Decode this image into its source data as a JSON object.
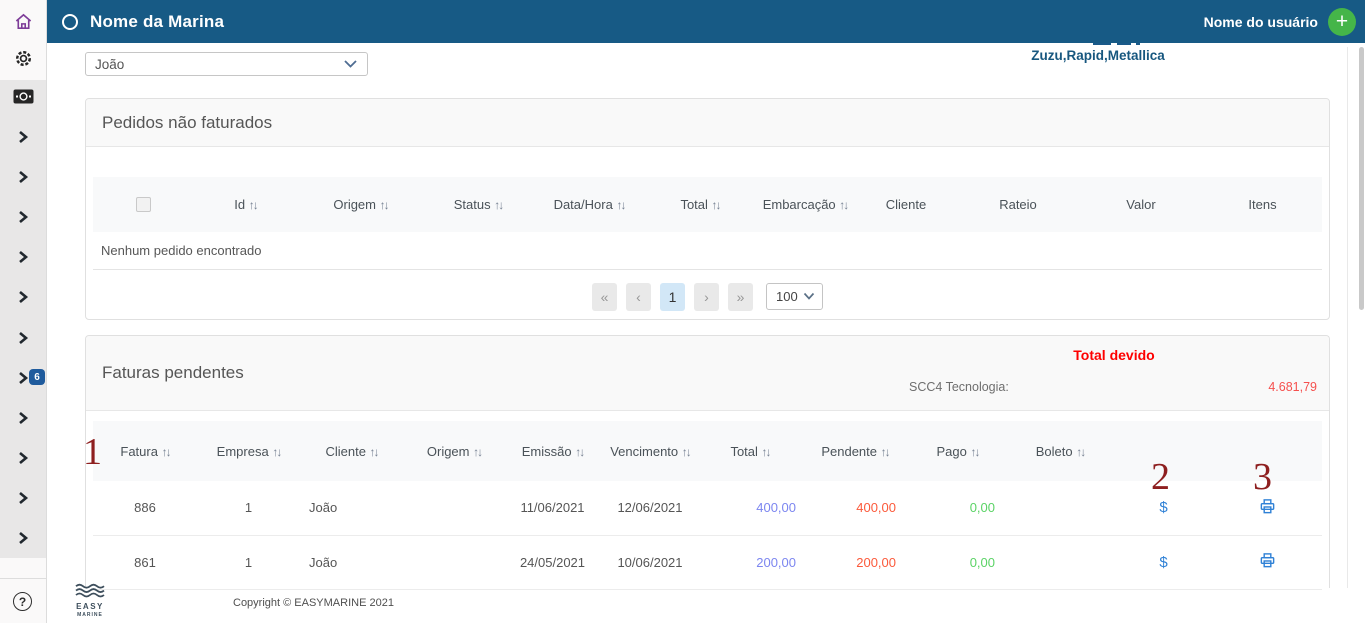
{
  "header": {
    "marina_name": "Nome da Marina",
    "user_name": "Nome do usuário",
    "add_label": "+"
  },
  "filters": {
    "client_select_value": "João",
    "boats_text": "Zuzu,Rapid,Metallica"
  },
  "sidebar": {
    "notification_badge": "6",
    "help_glyph": "?"
  },
  "icons": {
    "sort": "↑↓",
    "dollar": "$"
  },
  "pedidos": {
    "title": "Pedidos não faturados",
    "columns": [
      {
        "label": "Id"
      },
      {
        "label": "Origem"
      },
      {
        "label": "Status"
      },
      {
        "label": "Data/Hora"
      },
      {
        "label": "Total"
      },
      {
        "label": "Embarcação"
      },
      {
        "label": "Cliente"
      },
      {
        "label": "Rateio"
      },
      {
        "label": "Valor"
      },
      {
        "label": "Itens"
      }
    ],
    "empty_message": "Nenhum pedido encontrado",
    "pagination": {
      "first": "«",
      "prev": "‹",
      "current_page": "1",
      "next": "›",
      "last": "»",
      "page_size": "100"
    }
  },
  "faturas": {
    "title": "Faturas pendentes",
    "total_devido_label": "Total devido",
    "debtor_label": "SCC4 Tecnologia:",
    "total_devido_value": "4.681,79",
    "columns": [
      {
        "label": "Fatura"
      },
      {
        "label": "Empresa"
      },
      {
        "label": "Cliente"
      },
      {
        "label": "Origem"
      },
      {
        "label": "Emissão"
      },
      {
        "label": "Vencimento"
      },
      {
        "label": "Total"
      },
      {
        "label": "Pendente"
      },
      {
        "label": "Pago"
      },
      {
        "label": "Boleto"
      }
    ],
    "rows": [
      {
        "fatura": "886",
        "empresa": "1",
        "cliente": "João",
        "origem": "",
        "emissao": "11/06/2021",
        "vencimento": "12/06/2021",
        "total": "400,00",
        "pendente": "400,00",
        "pago": "0,00",
        "boleto": ""
      },
      {
        "fatura": "861",
        "empresa": "1",
        "cliente": "João",
        "origem": "",
        "emissao": "24/05/2021",
        "vencimento": "10/06/2021",
        "total": "200,00",
        "pendente": "200,00",
        "pago": "0,00",
        "boleto": ""
      }
    ]
  },
  "annotations": {
    "one": "1",
    "two": "2",
    "three": "3"
  },
  "footer": {
    "logo_top": "EASY",
    "logo_bottom": "MARINE",
    "copyright": "Copyright © EASYMARINE 2021"
  }
}
